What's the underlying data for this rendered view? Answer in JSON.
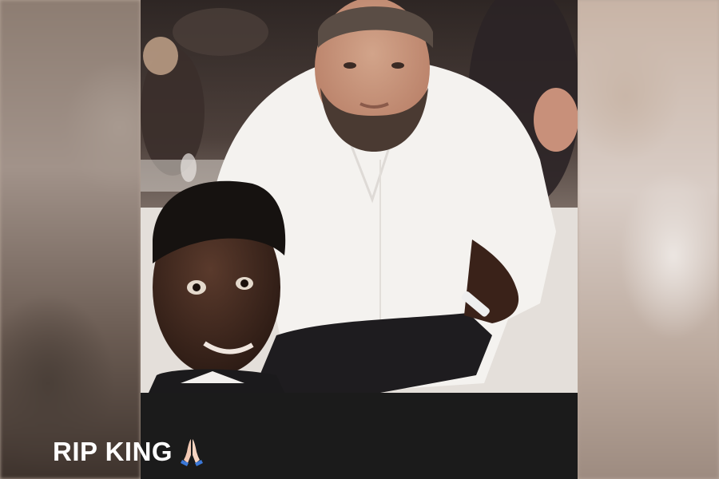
{
  "story": {
    "caption_text": "RIP KING",
    "caption_emoji_icon": "folded-hands-icon"
  },
  "colors": {
    "caption_bar": "#1b1b1b",
    "caption_text": "#ffffff",
    "shirt": "#f4f2ef",
    "jacket": "#1e1c1f"
  }
}
